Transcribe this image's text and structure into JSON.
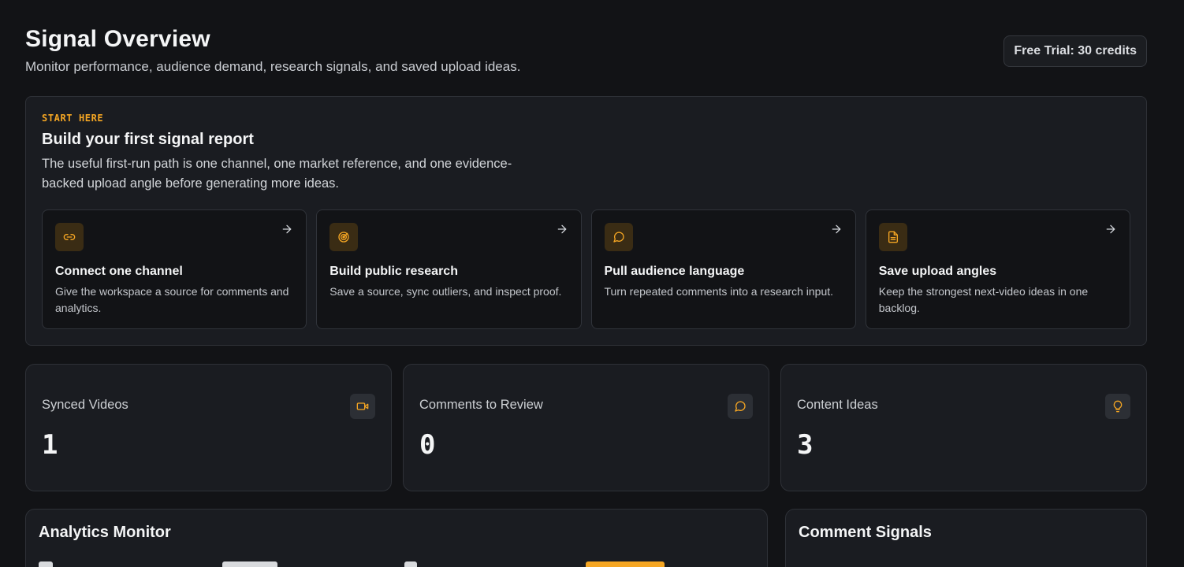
{
  "header": {
    "title": "Signal Overview",
    "subtitle": "Monitor performance, audience demand, research signals, and saved upload ideas.",
    "trial_badge": "Free Trial: 30 credits"
  },
  "start": {
    "eyebrow": "START HERE",
    "title": "Build your first signal report",
    "description": "The useful first-run path is one channel, one market reference, and one evidence-backed upload angle before generating more ideas.",
    "steps": [
      {
        "title": "Connect one channel",
        "description": "Give the workspace a source for comments and analytics.",
        "icon": "link-icon"
      },
      {
        "title": "Build public research",
        "description": "Save a source, sync outliers, and inspect proof.",
        "icon": "radar-icon"
      },
      {
        "title": "Pull audience language",
        "description": "Turn repeated comments into a research input.",
        "icon": "message-icon"
      },
      {
        "title": "Save upload angles",
        "description": "Keep the strongest next-video ideas in one backlog.",
        "icon": "document-icon"
      }
    ]
  },
  "stats": [
    {
      "label": "Synced Videos",
      "value": "1",
      "icon": "video-icon"
    },
    {
      "label": "Comments to Review",
      "value": "0",
      "icon": "message-icon"
    },
    {
      "label": "Content Ideas",
      "value": "3",
      "icon": "lightbulb-icon"
    }
  ],
  "panels": {
    "analytics_title": "Analytics Monitor",
    "comments_title": "Comment Signals"
  },
  "colors": {
    "accent": "#f5a623",
    "background": "#121316",
    "card": "#1a1c21"
  }
}
